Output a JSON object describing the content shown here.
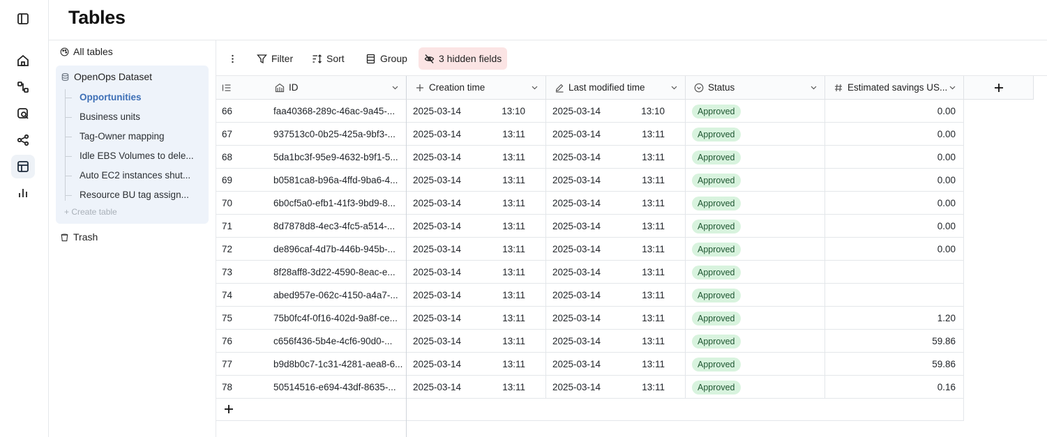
{
  "page": {
    "title": "Tables"
  },
  "rail": {
    "items": [
      {
        "icon": "sidebar-toggle-icon"
      },
      {
        "icon": "home-icon"
      },
      {
        "icon": "flows-icon"
      },
      {
        "icon": "opportunities-search-icon"
      },
      {
        "icon": "connections-icon"
      },
      {
        "icon": "tables-icon",
        "active": true
      },
      {
        "icon": "analytics-icon"
      }
    ]
  },
  "tree": {
    "all_tables": "All tables",
    "dataset": "OpenOps Dataset",
    "tables": [
      "Opportunities",
      "Business units",
      "Tag-Owner mapping",
      "Idle EBS Volumes to dele...",
      "Auto EC2 instances shut...",
      "Resource BU tag assign..."
    ],
    "selected_table": "Opportunities",
    "create_table": "+ Create table",
    "trash": "Trash"
  },
  "toolbar": {
    "filter": "Filter",
    "sort": "Sort",
    "group": "Group",
    "hidden_fields": "3 hidden fields"
  },
  "columns": {
    "id": "ID",
    "creation_time": "Creation time",
    "last_modified": "Last modified time",
    "status": "Status",
    "savings": "Estimated savings US..."
  },
  "rows": [
    {
      "num": "66",
      "id": "faa40368-289c-46ac-9a45-...",
      "c_date": "2025-03-14",
      "c_time": "13:10",
      "m_date": "2025-03-14",
      "m_time": "13:10",
      "status": "Approved",
      "savings": "0.00"
    },
    {
      "num": "67",
      "id": "937513c0-0b25-425a-9bf3-...",
      "c_date": "2025-03-14",
      "c_time": "13:11",
      "m_date": "2025-03-14",
      "m_time": "13:11",
      "status": "Approved",
      "savings": "0.00"
    },
    {
      "num": "68",
      "id": "5da1bc3f-95e9-4632-b9f1-5...",
      "c_date": "2025-03-14",
      "c_time": "13:11",
      "m_date": "2025-03-14",
      "m_time": "13:11",
      "status": "Approved",
      "savings": "0.00"
    },
    {
      "num": "69",
      "id": "b0581ca8-b96a-4ffd-9ba6-4...",
      "c_date": "2025-03-14",
      "c_time": "13:11",
      "m_date": "2025-03-14",
      "m_time": "13:11",
      "status": "Approved",
      "savings": "0.00"
    },
    {
      "num": "70",
      "id": "6b0cf5a0-efb1-41f3-9bd9-8...",
      "c_date": "2025-03-14",
      "c_time": "13:11",
      "m_date": "2025-03-14",
      "m_time": "13:11",
      "status": "Approved",
      "savings": "0.00"
    },
    {
      "num": "71",
      "id": "8d7878d8-4ec3-4fc5-a514-...",
      "c_date": "2025-03-14",
      "c_time": "13:11",
      "m_date": "2025-03-14",
      "m_time": "13:11",
      "status": "Approved",
      "savings": "0.00"
    },
    {
      "num": "72",
      "id": "de896caf-4d7b-446b-945b-...",
      "c_date": "2025-03-14",
      "c_time": "13:11",
      "m_date": "2025-03-14",
      "m_time": "13:11",
      "status": "Approved",
      "savings": "0.00"
    },
    {
      "num": "73",
      "id": "8f28aff8-3d22-4590-8eac-e...",
      "c_date": "2025-03-14",
      "c_time": "13:11",
      "m_date": "2025-03-14",
      "m_time": "13:11",
      "status": "Approved",
      "savings": ""
    },
    {
      "num": "74",
      "id": "abed957e-062c-4150-a4a7-...",
      "c_date": "2025-03-14",
      "c_time": "13:11",
      "m_date": "2025-03-14",
      "m_time": "13:11",
      "status": "Approved",
      "savings": ""
    },
    {
      "num": "75",
      "id": "75b0fc4f-0f16-402d-9a8f-ce...",
      "c_date": "2025-03-14",
      "c_time": "13:11",
      "m_date": "2025-03-14",
      "m_time": "13:11",
      "status": "Approved",
      "savings": "1.20"
    },
    {
      "num": "76",
      "id": "c656f436-5b4e-4cf6-90d0-...",
      "c_date": "2025-03-14",
      "c_time": "13:11",
      "m_date": "2025-03-14",
      "m_time": "13:11",
      "status": "Approved",
      "savings": "59.86"
    },
    {
      "num": "77",
      "id": "b9d8b0c7-1c31-4281-aea8-6...",
      "c_date": "2025-03-14",
      "c_time": "13:11",
      "m_date": "2025-03-14",
      "m_time": "13:11",
      "status": "Approved",
      "savings": "59.86"
    },
    {
      "num": "78",
      "id": "50514516-e694-43df-8635-...",
      "c_date": "2025-03-14",
      "c_time": "13:11",
      "m_date": "2025-03-14",
      "m_time": "13:11",
      "status": "Approved",
      "savings": "0.16"
    }
  ],
  "colors": {
    "accent": "#3d6fb6",
    "badge_bg": "#d8f3de",
    "badge_text": "#1e5631",
    "hidden_fields_bg": "#fbe4e4",
    "tree_bg": "#eef3fa"
  }
}
